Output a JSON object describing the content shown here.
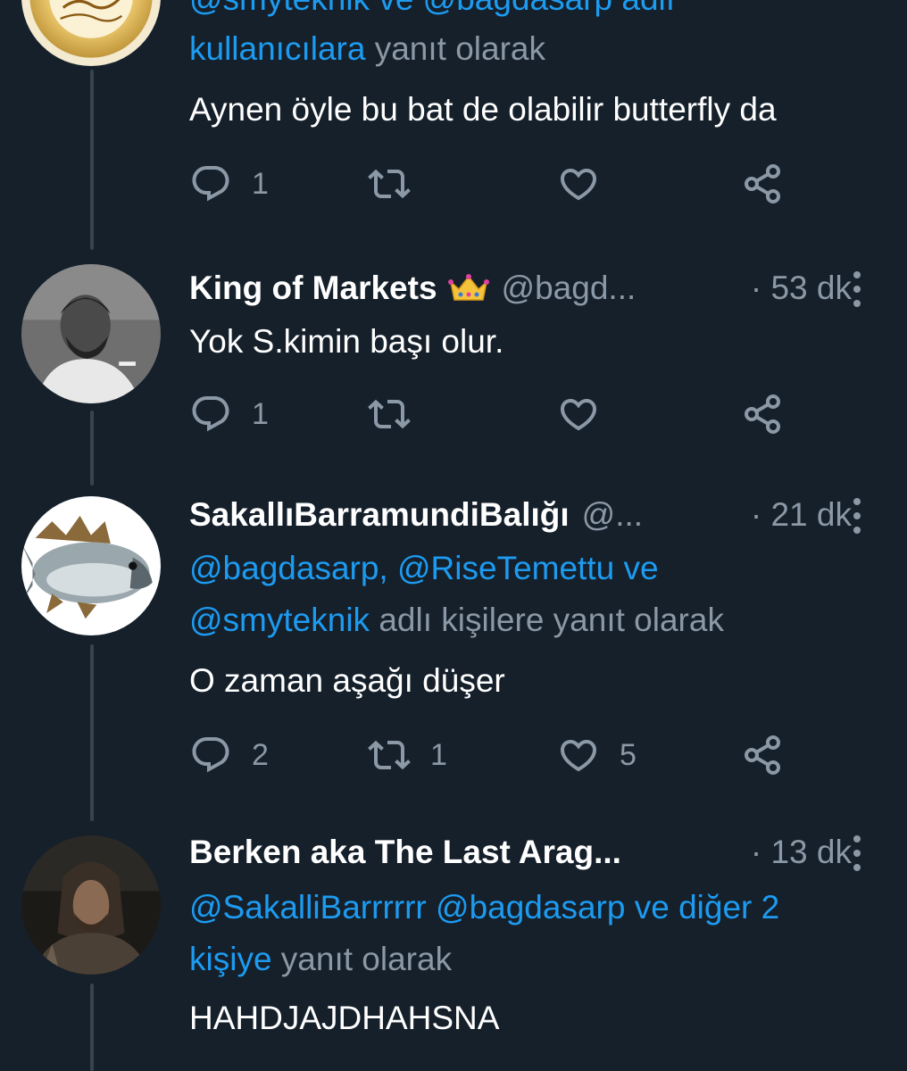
{
  "tweets": [
    {
      "reply_to": {
        "mentions_top": "@smyteknik ve @bagdasarp adlı",
        "mentions": "kullanıcılara",
        "suffix": " yanıt olarak"
      },
      "text": "Aynen öyle bu bat de olabilir butterfly da",
      "stats": {
        "replies": "1",
        "retweets": "",
        "likes": ""
      }
    },
    {
      "display_name": "King of Markets",
      "badge": "crown-emoji",
      "handle": "@bagd...",
      "time": "· 53 dk",
      "text": "Yok S.kimin başı olur.",
      "stats": {
        "replies": "1",
        "retweets": "",
        "likes": ""
      }
    },
    {
      "display_name": "SakallıBarramundiBalığı",
      "handle": "@...",
      "time": "· 21 dk",
      "reply_to": {
        "mentions_line1": "@bagdasarp, @RiseTemettu ve",
        "mentions_line2": "@smyteknik",
        "suffix": " adlı kişilere yanıt olarak"
      },
      "text": "O zaman aşağı düşer",
      "stats": {
        "replies": "2",
        "retweets": "1",
        "likes": "5"
      }
    },
    {
      "display_name": "Berken aka The Last Arag...",
      "handle": "",
      "time": "· 13 dk",
      "reply_to": {
        "mentions_line1": "@SakalliBarrrrrr @bagdasarp ve diğer 2",
        "mentions_line2": "kişiye",
        "suffix": " yanıt olarak"
      },
      "text": "HAHDJAJDHAHSNA"
    }
  ],
  "icons": {
    "reply": "reply-icon",
    "retweet": "retweet-icon",
    "like": "heart-icon",
    "share": "share-icon",
    "more": "more-vertical-icon"
  },
  "colors": {
    "background": "#15202b",
    "text_primary": "#ffffff",
    "text_secondary": "#8b98a5",
    "link": "#1d9bf0",
    "thread_line": "#38444d"
  }
}
